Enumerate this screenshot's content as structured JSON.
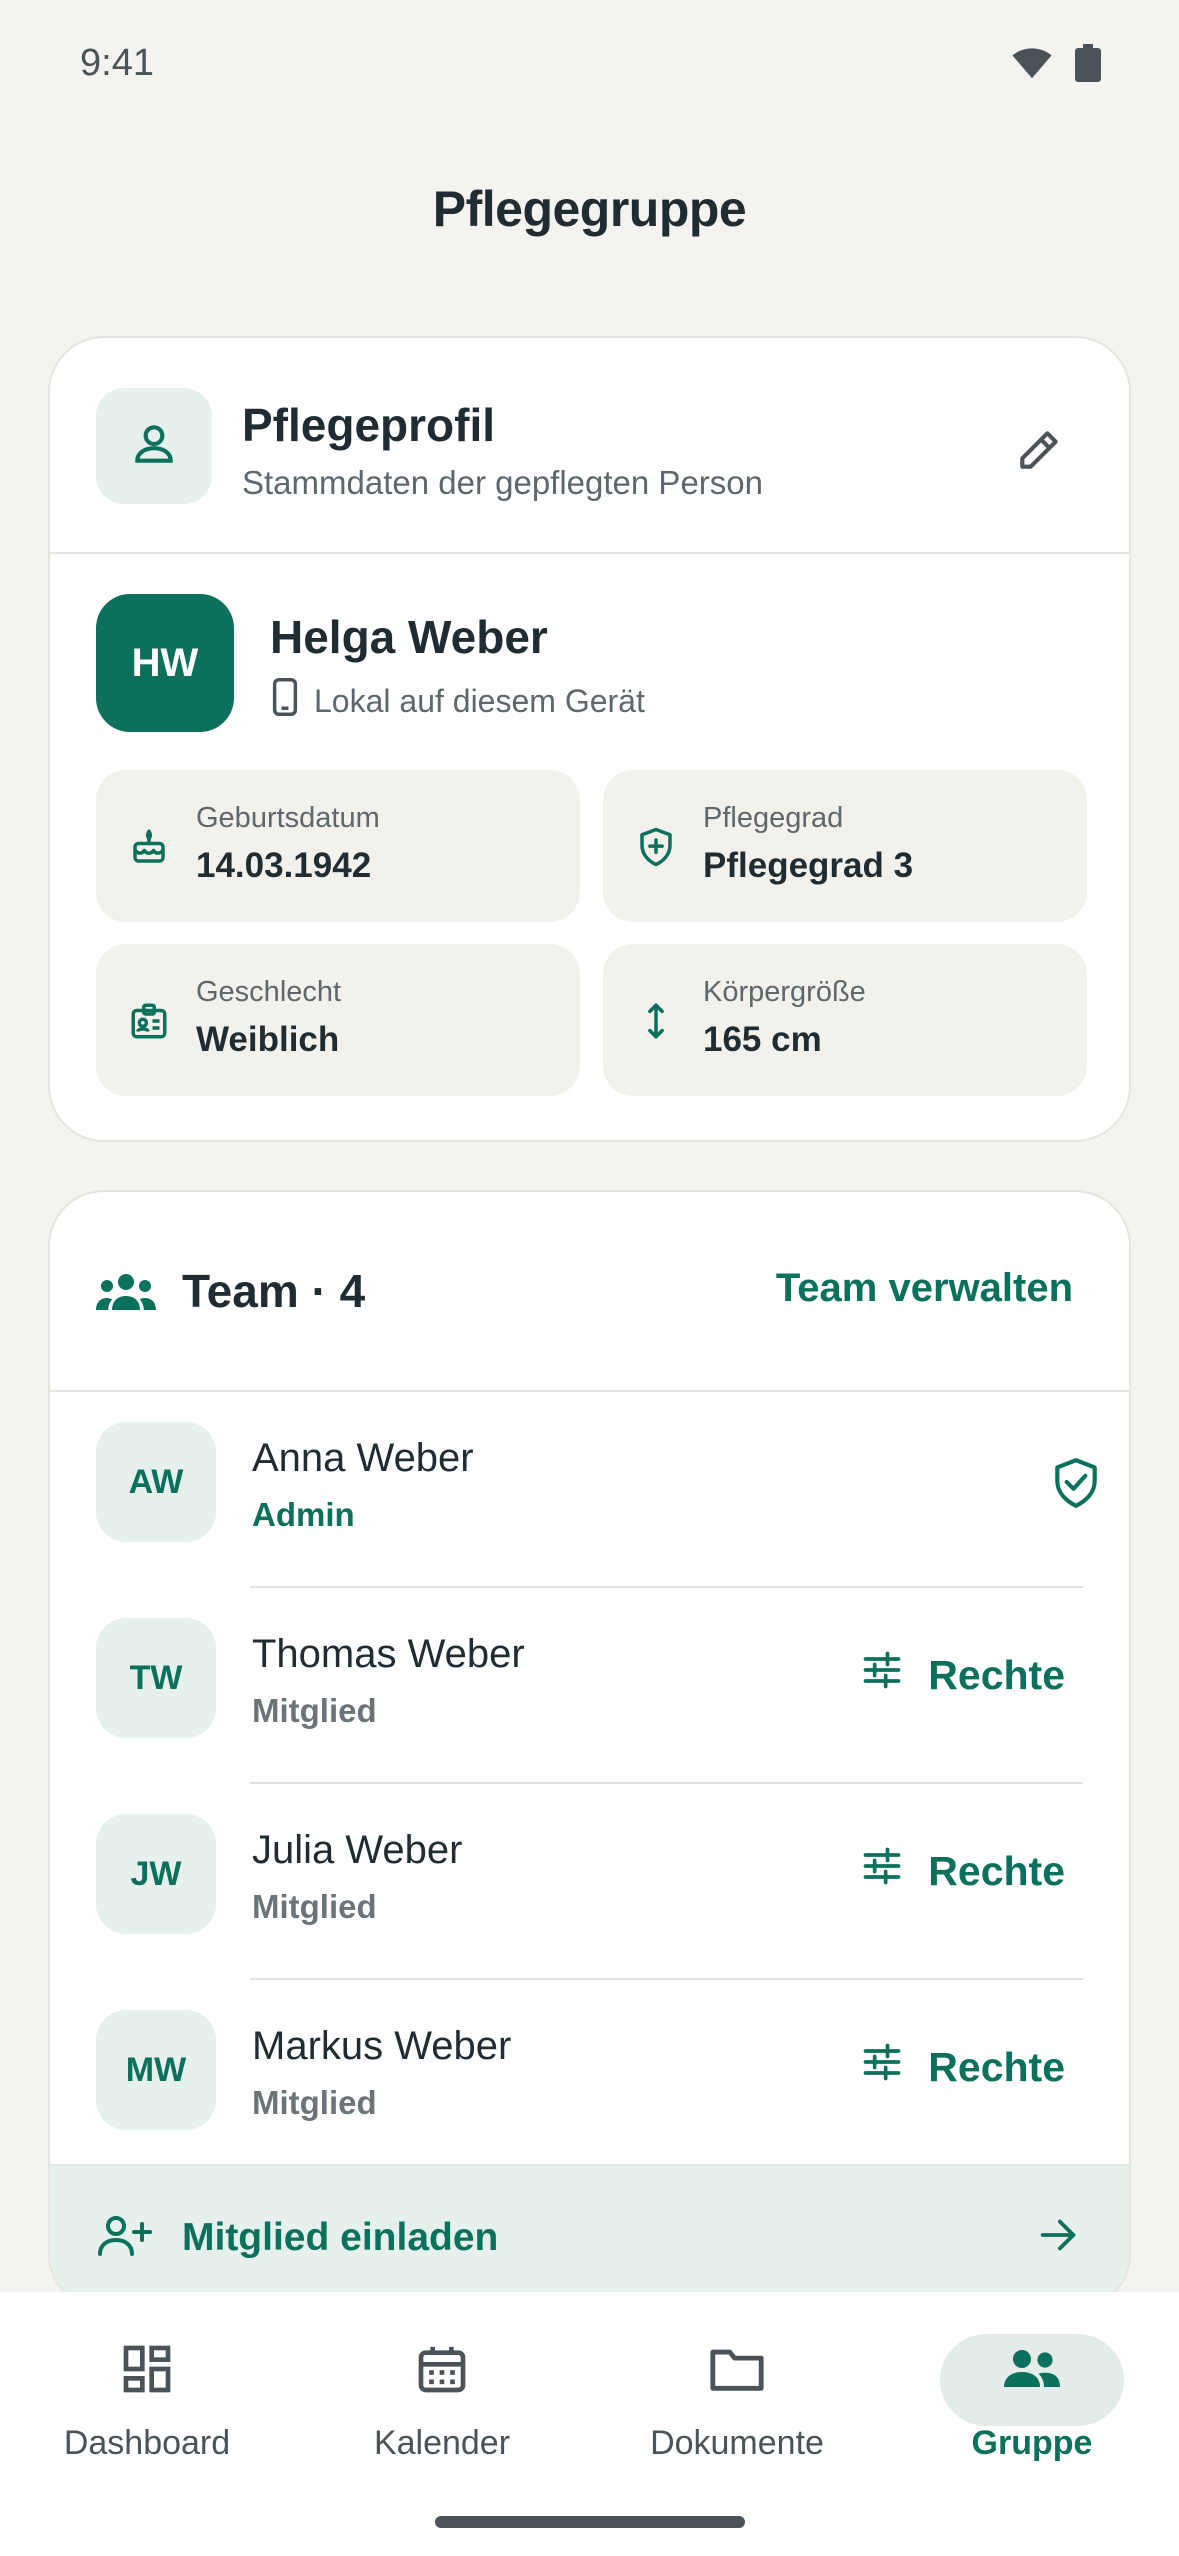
{
  "status_bar": {
    "time": "9:41"
  },
  "page": {
    "title": "Pflegegruppe"
  },
  "profile_card": {
    "title": "Pflegeprofil",
    "subtitle": "Stammdaten der gepflegten Person",
    "person": {
      "initials": "HW",
      "name": "Helga Weber",
      "storage": "Lokal auf diesem Gerät"
    },
    "fields": [
      {
        "label": "Geburtsdatum",
        "value": "14.03.1942",
        "icon": "cake-icon"
      },
      {
        "label": "Pflegegrad",
        "value": "Pflegegrad 3",
        "icon": "shield-plus-icon"
      },
      {
        "label": "Geschlecht",
        "value": "Weiblich",
        "icon": "id-badge-icon"
      },
      {
        "label": "Körpergröße",
        "value": "165 cm",
        "icon": "height-arrows-icon"
      }
    ]
  },
  "team_card": {
    "title": "Team · 4",
    "manage_label": "Team verwalten",
    "members": [
      {
        "initials": "AW",
        "name": "Anna Weber",
        "role": "Admin"
      },
      {
        "initials": "TW",
        "name": "Thomas Weber",
        "role": "Mitglied",
        "action": "Rechte"
      },
      {
        "initials": "JW",
        "name": "Julia Weber",
        "role": "Mitglied",
        "action": "Rechte"
      },
      {
        "initials": "MW",
        "name": "Markus Weber",
        "role": "Mitglied",
        "action": "Rechte"
      }
    ],
    "invite_label": "Mitglied einladen"
  },
  "bottom_nav": {
    "items": [
      {
        "label": "Dashboard",
        "icon": "dashboard-icon"
      },
      {
        "label": "Kalender",
        "icon": "calendar-icon"
      },
      {
        "label": "Dokumente",
        "icon": "folder-icon"
      },
      {
        "label": "Gruppe",
        "icon": "group-icon",
        "active": true
      }
    ]
  },
  "colors": {
    "accent": "#0b705c",
    "accent_soft": "#e6f0ec",
    "background": "#f4f3ef"
  }
}
